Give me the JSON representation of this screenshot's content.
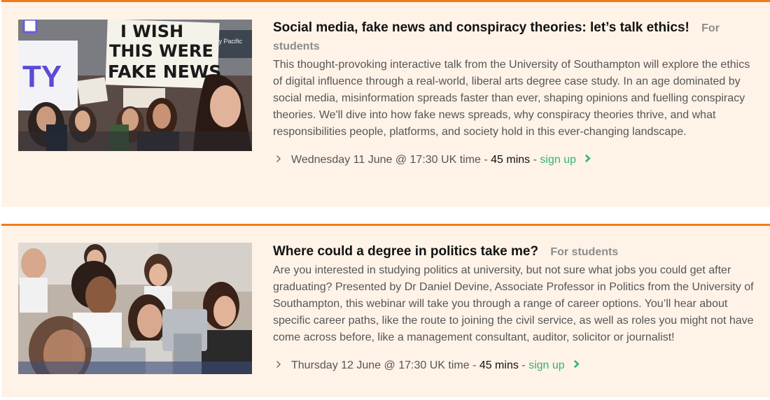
{
  "events": [
    {
      "title": "Social media, fake news and conspiracy theories: let’s talk ethics!",
      "audience": "For students",
      "description": "This thought-provoking interactive talk from the University of Southampton will explore the ethics of digital influence through a real-world, liberal arts degree case study. In an age dominated by social media, misinformation spreads faster than ever, shaping opinions and fuelling conspiracy theories. We'll dive into how fake news spreads, why conspiracy theories thrive, and what responsibilities people, platforms, and society hold in this ever-changing landscape.",
      "datetime": "Wednesday 11 June @ 17:30 UK time",
      "duration": "45 mins",
      "signup_label": "sign up",
      "image": {
        "sign_text_line1": "I WISH",
        "sign_text_line2": "THIS WERE",
        "sign_text_line3": "FAKE NEWS",
        "partial_sign_text": "TY",
        "background_sign_text": "thay Pacific"
      }
    },
    {
      "title": "Where could a degree in politics take me?",
      "audience": "For students",
      "description": "Are you interested in studying politics at university, but not sure what jobs you could get after graduating? Presented by Dr Daniel Devine, Associate Professor in Politics from the University of Southampton, this webinar will take you through a range of career options. You’ll hear about specific career paths, like the route to joining the civil service, as well as roles you might not have come across before, like a management consultant, auditor, solicitor or journalist!",
      "datetime": "Thursday 12 June @ 17:30 UK time",
      "duration": "45 mins",
      "signup_label": "sign up"
    }
  ],
  "colors": {
    "card_background": "#fff3e8",
    "accent_border": "#f07c1a",
    "title": "#111111",
    "audience": "#8c8c8c",
    "body_text": "#555555",
    "signup_link": "#2fb47a"
  },
  "icons": {
    "meta_bullet": "chevron-right-icon",
    "signup_arrow": "arrow-right-icon"
  }
}
